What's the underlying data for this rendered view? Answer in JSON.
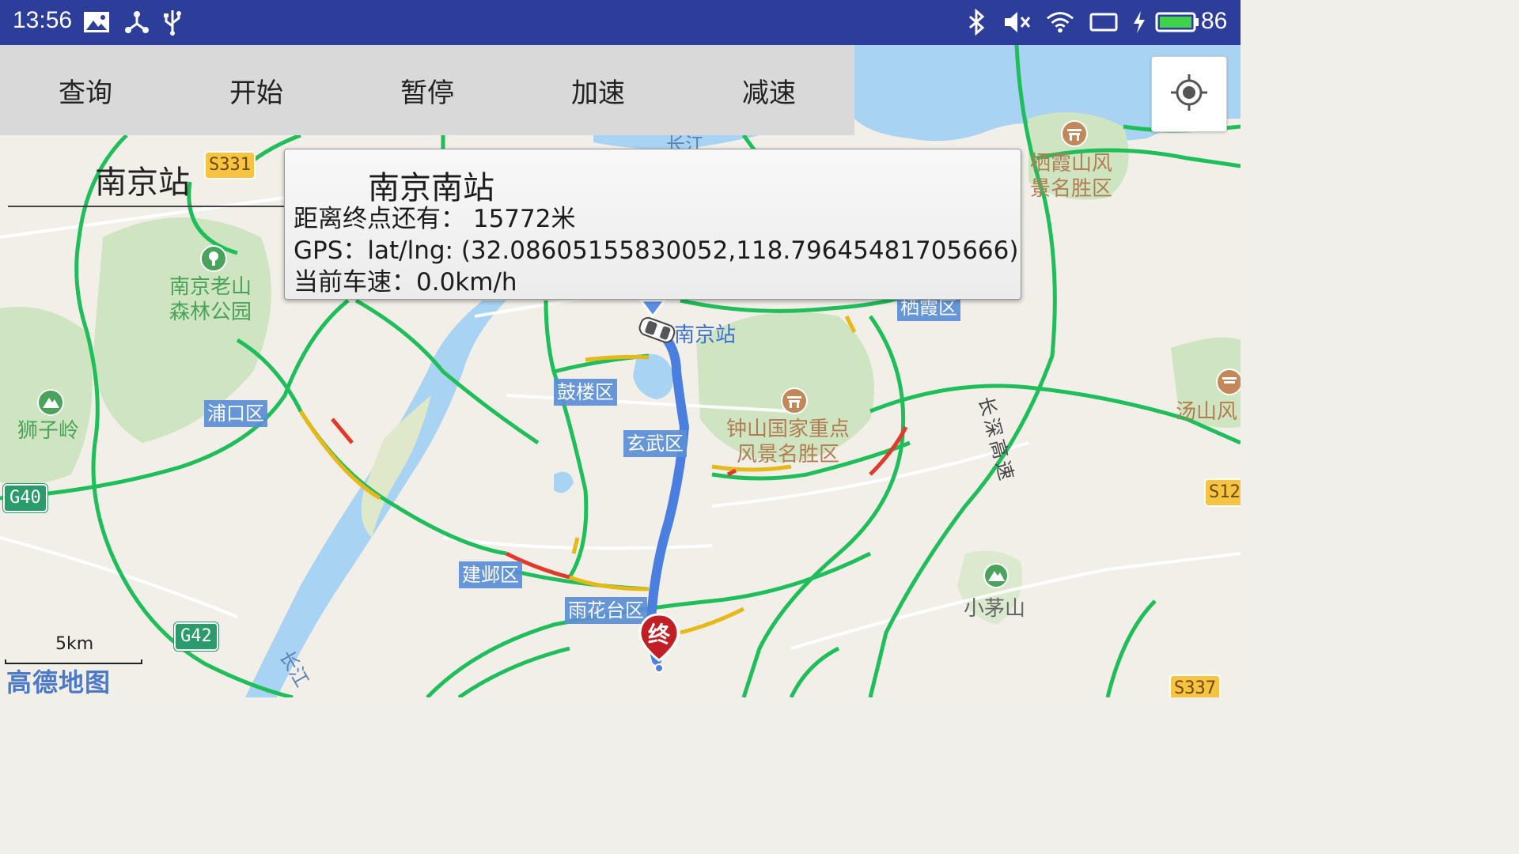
{
  "status_bar": {
    "time": "13:56",
    "left_icons": [
      "image-notification-icon",
      "share-network-icon",
      "usb-icon"
    ],
    "right_icons": [
      "bluetooth-icon",
      "volume-muted-icon",
      "wifi-icon",
      "screen-rotate-icon",
      "charging-icon",
      "battery-icon"
    ],
    "battery_percent": "86",
    "background_color": "#2d3d9a"
  },
  "toolbar": {
    "buttons": [
      {
        "label": "查询"
      },
      {
        "label": "开始"
      },
      {
        "label": "暂停"
      },
      {
        "label": "加速"
      },
      {
        "label": "减速"
      }
    ]
  },
  "map": {
    "start_marker_label": "南京站",
    "districts": [
      "浦口区",
      "鼓楼区",
      "玄武区",
      "建邺区",
      "雨花台区",
      "栖霞区"
    ],
    "pois": {
      "forest_park": "南京老山\n森林公园",
      "shizi_ling": "狮子岭",
      "zhongshan": "钟山国家重点\n风景名胜区",
      "qixia_shan": "栖霞山风\n景名胜区",
      "tangshan": "汤山风",
      "xiaomao_shan": "小茅山",
      "nanjing_station": "南京站",
      "changjiang_north": "长江",
      "changjiang_south": "长江",
      "changshen_highway": "长深高速"
    },
    "shields": [
      "S331",
      "G40",
      "G42",
      "S12",
      "S337"
    ],
    "end_marker_label": "终",
    "route_color": "#4a7fe0",
    "road_color": "#1fbe5a",
    "water_color": "#a9d3f2"
  },
  "info_window": {
    "title": "南京南站",
    "distance_line": "距离终点还有： 15772米",
    "gps_line": "GPS：lat/lng: (32.08605155830052,118.79645481705666)",
    "speed_line": "当前车速：0.0km/h"
  },
  "scale": {
    "label": "5km"
  },
  "logo": {
    "text": "高德地图"
  }
}
